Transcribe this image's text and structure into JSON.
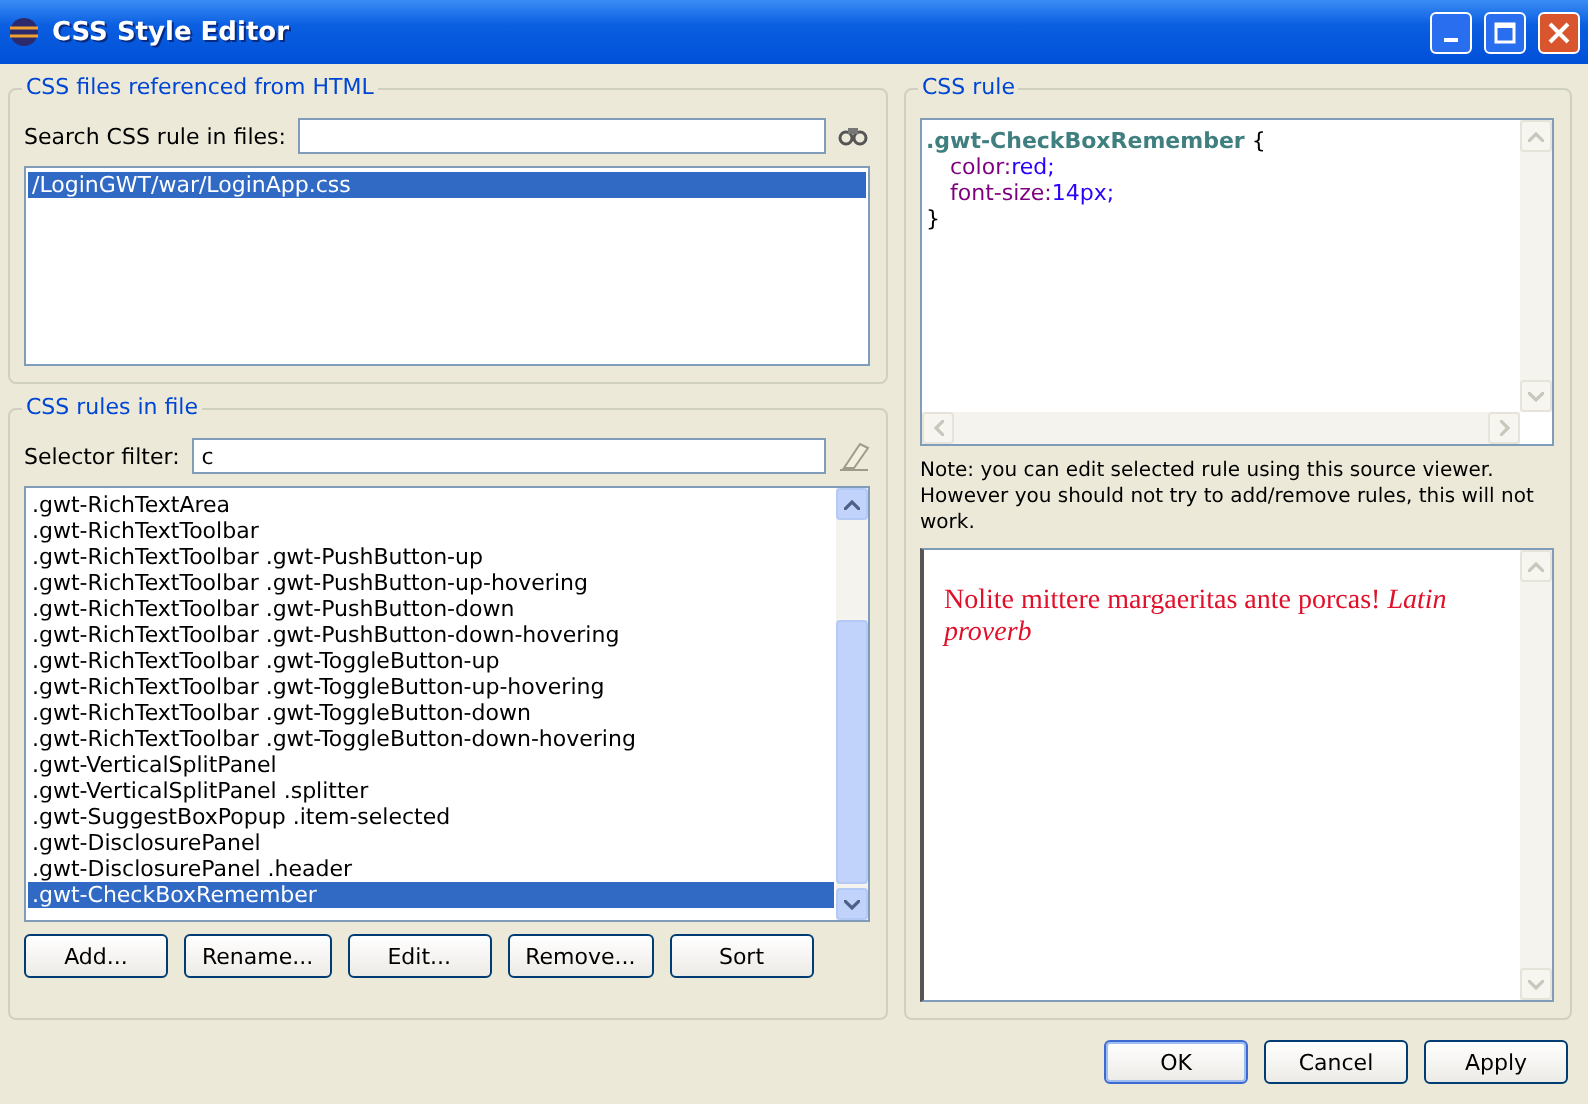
{
  "window": {
    "title": "CSS Style Editor"
  },
  "files_group": {
    "title": "CSS files referenced from HTML",
    "search_label": "Search CSS rule in files:",
    "files": [
      {
        "text": "/LoginGWT/war/LoginApp.css",
        "selected": true
      }
    ]
  },
  "rules_group": {
    "title": "CSS rules in file",
    "filter_label": "Selector filter:",
    "filter_value": "c",
    "rules": [
      {
        "text": ".gwt-RichTextArea",
        "selected": false
      },
      {
        "text": ".gwt-RichTextToolbar",
        "selected": false
      },
      {
        "text": ".gwt-RichTextToolbar .gwt-PushButton-up",
        "selected": false
      },
      {
        "text": ".gwt-RichTextToolbar .gwt-PushButton-up-hovering",
        "selected": false
      },
      {
        "text": ".gwt-RichTextToolbar .gwt-PushButton-down",
        "selected": false
      },
      {
        "text": ".gwt-RichTextToolbar .gwt-PushButton-down-hovering",
        "selected": false
      },
      {
        "text": ".gwt-RichTextToolbar .gwt-ToggleButton-up",
        "selected": false
      },
      {
        "text": ".gwt-RichTextToolbar .gwt-ToggleButton-up-hovering",
        "selected": false
      },
      {
        "text": ".gwt-RichTextToolbar .gwt-ToggleButton-down",
        "selected": false
      },
      {
        "text": ".gwt-RichTextToolbar .gwt-ToggleButton-down-hovering",
        "selected": false
      },
      {
        "text": ".gwt-VerticalSplitPanel",
        "selected": false
      },
      {
        "text": ".gwt-VerticalSplitPanel .splitter",
        "selected": false
      },
      {
        "text": ".gwt-SuggestBoxPopup .item-selected",
        "selected": false
      },
      {
        "text": ".gwt-DisclosurePanel",
        "selected": false
      },
      {
        "text": ".gwt-DisclosurePanel .header",
        "selected": false
      },
      {
        "text": ".gwt-CheckBoxRemember",
        "selected": true
      }
    ],
    "buttons": [
      "Add...",
      "Rename...",
      "Edit...",
      "Remove...",
      "Sort"
    ]
  },
  "rule_group": {
    "title": "CSS rule",
    "code": [
      {
        "kind": "selector",
        "name": ".gwt-CheckBoxRemember",
        "punct": " {"
      },
      {
        "kind": "declaration",
        "property": "color:",
        "value": "red;"
      },
      {
        "kind": "declaration",
        "property": "font-size:",
        "value": "14px;"
      },
      {
        "kind": "close",
        "punct": "}"
      }
    ],
    "note": "Note: you can edit selected rule using this source viewer. However you should not try to add/remove rules, this will not work.",
    "preview": "Nolite mittere margaeritas ante porcas! *Latin proverb*"
  },
  "dialog_buttons": [
    {
      "label": "OK",
      "default": true
    },
    {
      "label": "Cancel",
      "default": false
    },
    {
      "label": "Apply",
      "default": false
    }
  ]
}
